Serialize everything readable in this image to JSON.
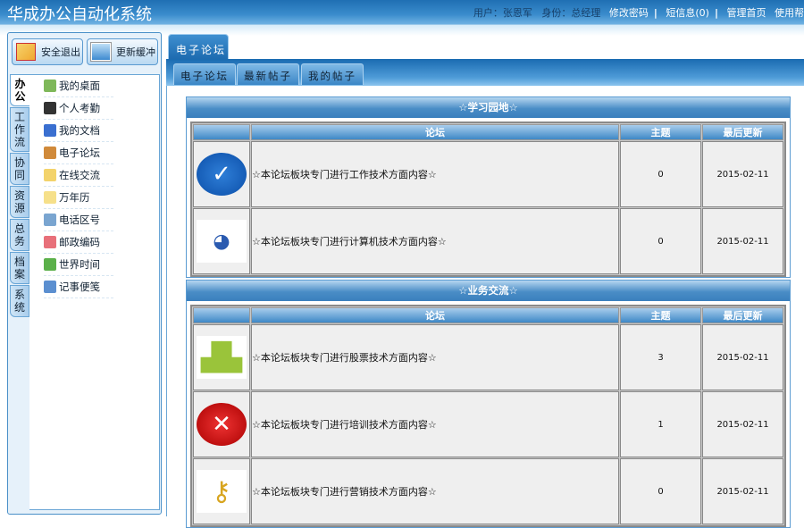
{
  "header": {
    "title": "华成办公自动化系统",
    "user_label": "用户：张恩军",
    "role_label": "身份：总经理",
    "links": [
      "修改密码",
      "短信息(0)",
      "管理首页",
      "使用帮"
    ]
  },
  "toolbar": {
    "logout": "安全退出",
    "refresh": "更新缓冲"
  },
  "vtabs": [
    "办公",
    "工作流",
    "协同",
    "资源",
    "总务",
    "档案",
    "系统"
  ],
  "menu": [
    {
      "label": "我的桌面",
      "icon": "desktop-check-icon",
      "color": "#7fb85a"
    },
    {
      "label": "个人考勤",
      "icon": "clock-icon",
      "color": "#333333"
    },
    {
      "label": "我的文档",
      "icon": "document-icon",
      "color": "#3a6fd0"
    },
    {
      "label": "电子论坛",
      "icon": "users-icon",
      "color": "#d08a3a"
    },
    {
      "label": "在线交流",
      "icon": "chat-bubble-icon",
      "color": "#f3d36b"
    },
    {
      "label": "万年历",
      "icon": "calendar-icon",
      "color": "#f6e08a"
    },
    {
      "label": "电话区号",
      "icon": "phone-book-icon",
      "color": "#7aa5d0"
    },
    {
      "label": "邮政编码",
      "icon": "heart-icon",
      "color": "#e8707a"
    },
    {
      "label": "世界时间",
      "icon": "refresh-globe-icon",
      "color": "#5bb04a"
    },
    {
      "label": "记事便笺",
      "icon": "notepad-icon",
      "color": "#5b8fd0"
    }
  ],
  "main_tab": "电子论坛",
  "sub_tabs": [
    "电子论坛",
    "最新帖子",
    "我的帖子"
  ],
  "columns": {
    "forum": "论坛",
    "topics": "主题",
    "updated": "最后更新"
  },
  "sections": [
    {
      "title": "☆学习园地☆",
      "rows": [
        {
          "icon": "check-circle-icon",
          "desc": "☆本论坛板块专门进行工作技术方面内容☆",
          "topics": "0",
          "updated": "2015-02-11"
        },
        {
          "icon": "cartoon-duck-icon",
          "desc": "☆本论坛板块专门进行计算机技术方面内容☆",
          "topics": "0",
          "updated": "2015-02-11"
        }
      ]
    },
    {
      "title": "☆业务交流☆",
      "rows": [
        {
          "icon": "world-map-icon",
          "desc": "☆本论坛板块专门进行股票技术方面内容☆",
          "topics": "3",
          "updated": "2015-02-11"
        },
        {
          "icon": "close-circle-icon",
          "desc": "☆本论坛板块专门进行培训技术方面内容☆",
          "topics": "1",
          "updated": "2015-02-11"
        },
        {
          "icon": "keys-icon",
          "desc": "☆本论坛板块专门进行营销技术方面内容☆",
          "topics": "0",
          "updated": "2015-02-11"
        }
      ]
    }
  ]
}
